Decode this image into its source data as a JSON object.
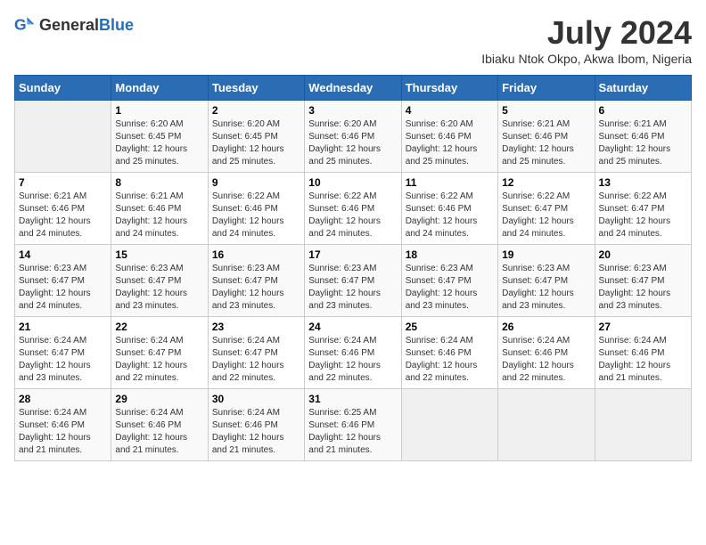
{
  "header": {
    "logo_general": "General",
    "logo_blue": "Blue",
    "title": "July 2024",
    "subtitle": "Ibiaku Ntok Okpo, Akwa Ibom, Nigeria"
  },
  "weekdays": [
    "Sunday",
    "Monday",
    "Tuesday",
    "Wednesday",
    "Thursday",
    "Friday",
    "Saturday"
  ],
  "weeks": [
    [
      {
        "day": "",
        "info": ""
      },
      {
        "day": "1",
        "info": "Sunrise: 6:20 AM\nSunset: 6:45 PM\nDaylight: 12 hours\nand 25 minutes."
      },
      {
        "day": "2",
        "info": "Sunrise: 6:20 AM\nSunset: 6:45 PM\nDaylight: 12 hours\nand 25 minutes."
      },
      {
        "day": "3",
        "info": "Sunrise: 6:20 AM\nSunset: 6:46 PM\nDaylight: 12 hours\nand 25 minutes."
      },
      {
        "day": "4",
        "info": "Sunrise: 6:20 AM\nSunset: 6:46 PM\nDaylight: 12 hours\nand 25 minutes."
      },
      {
        "day": "5",
        "info": "Sunrise: 6:21 AM\nSunset: 6:46 PM\nDaylight: 12 hours\nand 25 minutes."
      },
      {
        "day": "6",
        "info": "Sunrise: 6:21 AM\nSunset: 6:46 PM\nDaylight: 12 hours\nand 25 minutes."
      }
    ],
    [
      {
        "day": "7",
        "info": "Sunrise: 6:21 AM\nSunset: 6:46 PM\nDaylight: 12 hours\nand 24 minutes."
      },
      {
        "day": "8",
        "info": "Sunrise: 6:21 AM\nSunset: 6:46 PM\nDaylight: 12 hours\nand 24 minutes."
      },
      {
        "day": "9",
        "info": "Sunrise: 6:22 AM\nSunset: 6:46 PM\nDaylight: 12 hours\nand 24 minutes."
      },
      {
        "day": "10",
        "info": "Sunrise: 6:22 AM\nSunset: 6:46 PM\nDaylight: 12 hours\nand 24 minutes."
      },
      {
        "day": "11",
        "info": "Sunrise: 6:22 AM\nSunset: 6:46 PM\nDaylight: 12 hours\nand 24 minutes."
      },
      {
        "day": "12",
        "info": "Sunrise: 6:22 AM\nSunset: 6:47 PM\nDaylight: 12 hours\nand 24 minutes."
      },
      {
        "day": "13",
        "info": "Sunrise: 6:22 AM\nSunset: 6:47 PM\nDaylight: 12 hours\nand 24 minutes."
      }
    ],
    [
      {
        "day": "14",
        "info": "Sunrise: 6:23 AM\nSunset: 6:47 PM\nDaylight: 12 hours\nand 24 minutes."
      },
      {
        "day": "15",
        "info": "Sunrise: 6:23 AM\nSunset: 6:47 PM\nDaylight: 12 hours\nand 23 minutes."
      },
      {
        "day": "16",
        "info": "Sunrise: 6:23 AM\nSunset: 6:47 PM\nDaylight: 12 hours\nand 23 minutes."
      },
      {
        "day": "17",
        "info": "Sunrise: 6:23 AM\nSunset: 6:47 PM\nDaylight: 12 hours\nand 23 minutes."
      },
      {
        "day": "18",
        "info": "Sunrise: 6:23 AM\nSunset: 6:47 PM\nDaylight: 12 hours\nand 23 minutes."
      },
      {
        "day": "19",
        "info": "Sunrise: 6:23 AM\nSunset: 6:47 PM\nDaylight: 12 hours\nand 23 minutes."
      },
      {
        "day": "20",
        "info": "Sunrise: 6:23 AM\nSunset: 6:47 PM\nDaylight: 12 hours\nand 23 minutes."
      }
    ],
    [
      {
        "day": "21",
        "info": "Sunrise: 6:24 AM\nSunset: 6:47 PM\nDaylight: 12 hours\nand 23 minutes."
      },
      {
        "day": "22",
        "info": "Sunrise: 6:24 AM\nSunset: 6:47 PM\nDaylight: 12 hours\nand 22 minutes."
      },
      {
        "day": "23",
        "info": "Sunrise: 6:24 AM\nSunset: 6:47 PM\nDaylight: 12 hours\nand 22 minutes."
      },
      {
        "day": "24",
        "info": "Sunrise: 6:24 AM\nSunset: 6:46 PM\nDaylight: 12 hours\nand 22 minutes."
      },
      {
        "day": "25",
        "info": "Sunrise: 6:24 AM\nSunset: 6:46 PM\nDaylight: 12 hours\nand 22 minutes."
      },
      {
        "day": "26",
        "info": "Sunrise: 6:24 AM\nSunset: 6:46 PM\nDaylight: 12 hours\nand 22 minutes."
      },
      {
        "day": "27",
        "info": "Sunrise: 6:24 AM\nSunset: 6:46 PM\nDaylight: 12 hours\nand 21 minutes."
      }
    ],
    [
      {
        "day": "28",
        "info": "Sunrise: 6:24 AM\nSunset: 6:46 PM\nDaylight: 12 hours\nand 21 minutes."
      },
      {
        "day": "29",
        "info": "Sunrise: 6:24 AM\nSunset: 6:46 PM\nDaylight: 12 hours\nand 21 minutes."
      },
      {
        "day": "30",
        "info": "Sunrise: 6:24 AM\nSunset: 6:46 PM\nDaylight: 12 hours\nand 21 minutes."
      },
      {
        "day": "31",
        "info": "Sunrise: 6:25 AM\nSunset: 6:46 PM\nDaylight: 12 hours\nand 21 minutes."
      },
      {
        "day": "",
        "info": ""
      },
      {
        "day": "",
        "info": ""
      },
      {
        "day": "",
        "info": ""
      }
    ]
  ]
}
